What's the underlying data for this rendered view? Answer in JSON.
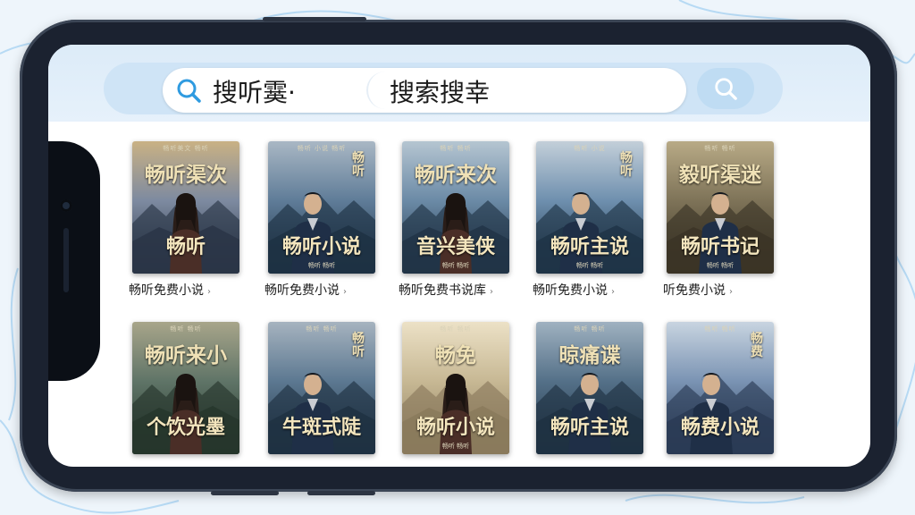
{
  "search": {
    "hint": "搜听霙·",
    "value": "搜索搜幸"
  },
  "icons": {
    "search_left": "search-icon",
    "search_button": "search-icon"
  },
  "colors": {
    "accent": "#bfdcf3",
    "strip": "#dcebf8"
  },
  "books": [
    {
      "top_line": "畅听美文 畅听",
      "title_top": "畅听渠次",
      "title_side": "",
      "title_bottom": "畅听",
      "bottom_line": "",
      "caption": "畅听免费小说"
    },
    {
      "top_line": "畅听 小说 畅听",
      "title_top": "",
      "title_side": "畅听",
      "title_bottom": "畅听小说",
      "bottom_line": "畅听 畅听",
      "caption": "畅听免费小说"
    },
    {
      "top_line": "畅听 畅听",
      "title_top": "畅听来次",
      "title_side": "",
      "title_bottom": "音兴美侠",
      "bottom_line": "畅听 畅听",
      "caption": "畅听免费书说库"
    },
    {
      "top_line": "畅听 小说",
      "title_top": "",
      "title_side": "畅听",
      "title_bottom": "畅听主说",
      "bottom_line": "畅听 畅听",
      "caption": "畅听免费小说"
    },
    {
      "top_line": "畅听 畅听",
      "title_top": "毅听渠迷",
      "title_side": "",
      "title_bottom": "畅听书记",
      "bottom_line": "畅听 畅听",
      "caption": "听免费小说"
    },
    {
      "top_line": "畅听 畅听",
      "title_top": "畅听来小",
      "title_side": "",
      "title_bottom": "个饮光墨",
      "bottom_line": "",
      "caption": ""
    },
    {
      "top_line": "畅听 畅听",
      "title_top": "",
      "title_side": "畅听",
      "title_bottom": "牛斑式陡",
      "bottom_line": "",
      "caption": ""
    },
    {
      "top_line": "畅听 畅听",
      "title_top": "畅免",
      "title_side": "",
      "title_bottom": "畅听小说",
      "bottom_line": "畅听 畅听",
      "caption": ""
    },
    {
      "top_line": "畅听 畅听",
      "title_top": "晾痛谍",
      "title_side": "",
      "title_bottom": "畅听主说",
      "bottom_line": "",
      "caption": ""
    },
    {
      "top_line": "畅听 畅听",
      "title_top": "",
      "title_side": "畅费",
      "title_bottom": "畅费小说",
      "bottom_line": "",
      "caption": ""
    }
  ]
}
